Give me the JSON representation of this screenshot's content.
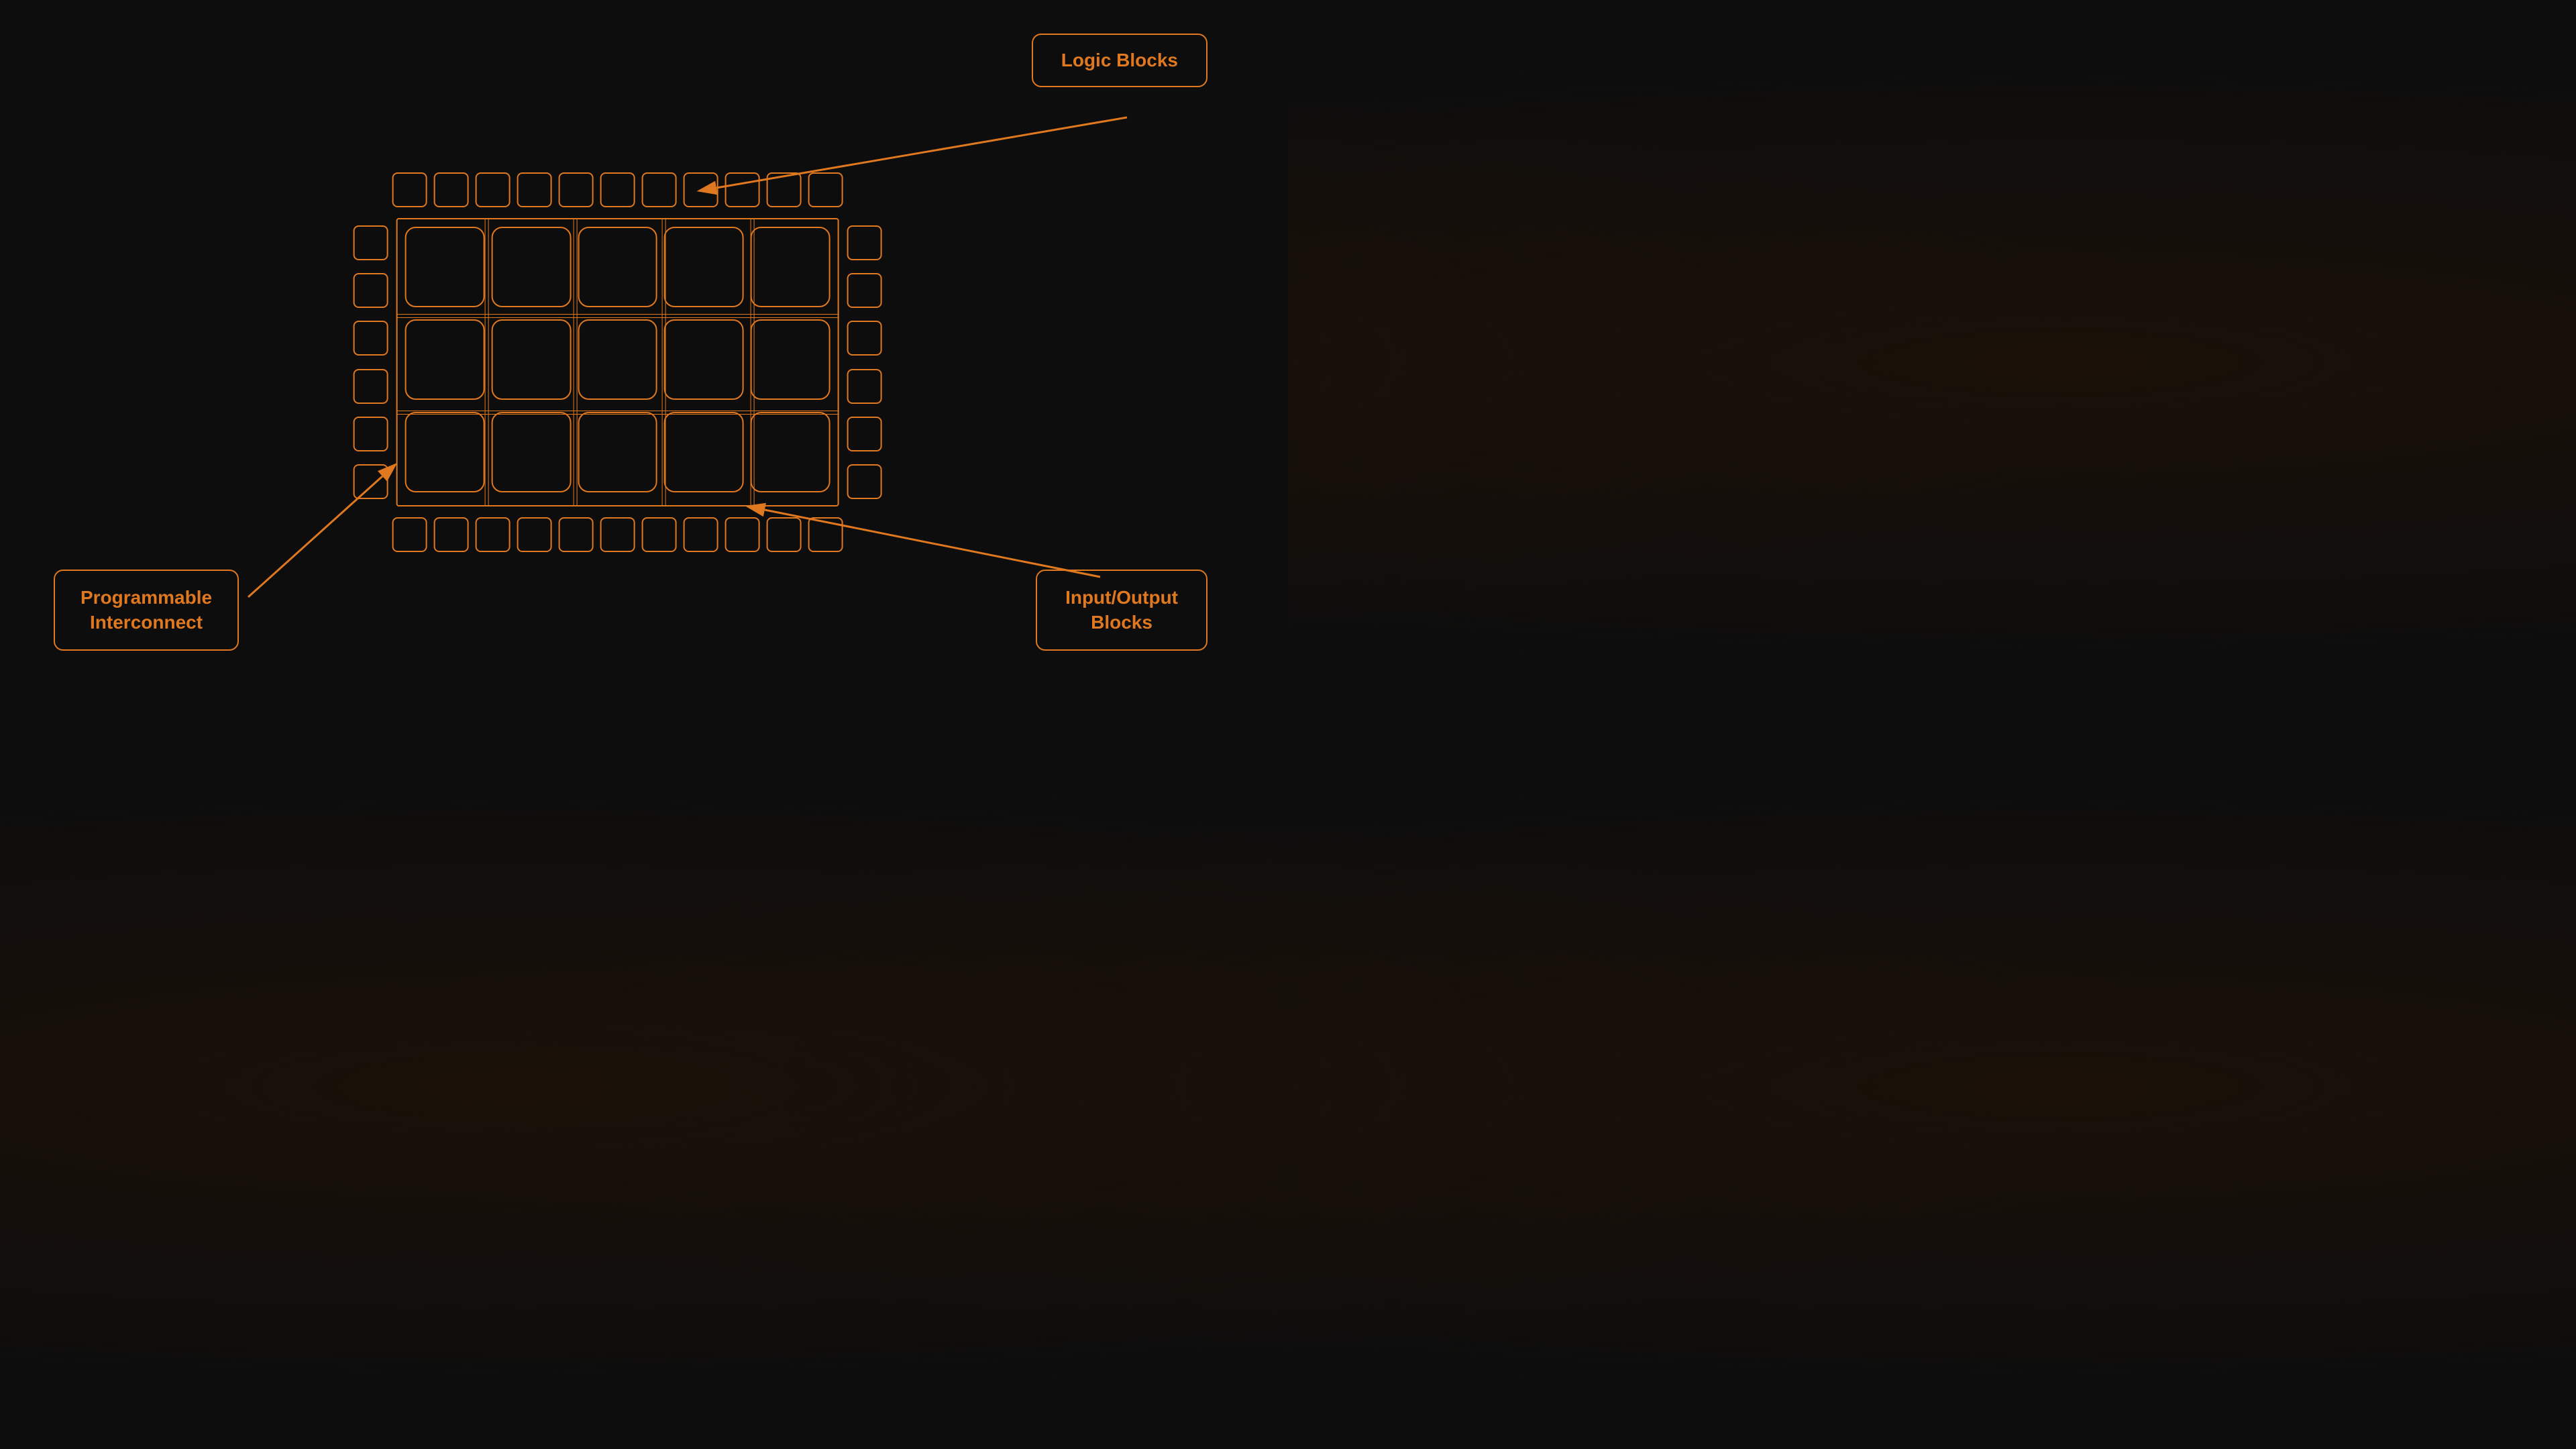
{
  "diagram": {
    "topRowCount": 11,
    "bottomRowCount": 11,
    "leftColCount": 6,
    "rightColCount": 6,
    "gridCols": 5,
    "gridRows": 3
  },
  "labels": {
    "logicBlocks": "Logic Blocks",
    "programmableInterconnect1": "Programmable",
    "programmableInterconnect2": "Interconnect",
    "inputOutputBlocks1": "Input/Output",
    "inputOutputBlocks2": "Blocks"
  },
  "colors": {
    "orange": "#e07820",
    "background": "#0d0d0d"
  }
}
